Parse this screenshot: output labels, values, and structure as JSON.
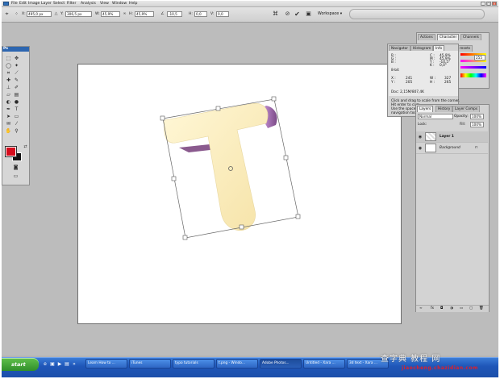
{
  "menu": {
    "items": [
      "File",
      "Edit",
      "Image",
      "Layer",
      "Select",
      "Filter",
      "Analysis",
      "View",
      "Window",
      "Help"
    ]
  },
  "options": {
    "x_label": "X:",
    "x_value": "495,0 px",
    "y_label": "Y:",
    "y_value": "306,5 px",
    "w_label": "W:",
    "w_value": "45,9%",
    "h_label": "H:",
    "h_value": "45,9%",
    "angle_value": "-10,5",
    "h_skew_label": "H:",
    "h_skew_value": "0,0",
    "v_skew_label": "V:",
    "v_skew_value": "0,0",
    "workspace_label": "Workspace ▾"
  },
  "tools": {
    "header": "Ps"
  },
  "panels": {
    "actions_tab": "Actions",
    "character_tab": "Character",
    "channels_tab": "Channels",
    "navigator_tab": "Navigator",
    "histogram_tab": "Histogram",
    "info_tab": "Info",
    "paths_tab": "Paths",
    "presets_tab": "resets",
    "color_value": "255"
  },
  "info": {
    "r_label": "R :",
    "g_label": "G :",
    "b_label": "B :",
    "c_label": "C :",
    "m_label": "M :",
    "y_label": "Y :",
    "k_label": "K :",
    "c_val": "45,9%",
    "m_val": "45,9%",
    "y_val": "-10,5°",
    "k_val": "0,0°",
    "bits_left": "8-bit",
    "x_label": "X :",
    "y2_label": "Y :",
    "x_val": "241",
    "y2_val": "205",
    "w_label": "W :",
    "h_label": "H :",
    "w_val": "327",
    "h_val": "265",
    "doc": "Doc: 2,15M/807,4K",
    "help1": "Click and drag to scale from the corner.",
    "help2": "Hit enter to com",
    "help3": "Use the spaceb",
    "help4": "navigation tools"
  },
  "layers": {
    "tab_layers": "Layers",
    "tab_history": "History",
    "tab_comps": "Layer Comps",
    "blend_mode": "Normal",
    "opacity_label": "Opacity:",
    "opacity_value": "100%",
    "lock_label": "Lock:",
    "fill_label": "Fill:",
    "fill_value": "100%",
    "rows": [
      {
        "name": "Layer 1"
      },
      {
        "name": "Background"
      }
    ]
  },
  "taskbar": {
    "start": "start",
    "tasks": [
      "Learn How to ...",
      "iTunes",
      "typo tutorials",
      "t.png - Windo...",
      "Adobe Photos...",
      "Untitled - Xara ...",
      "3d text - Xara ..."
    ],
    "watermark": "查字典 教程 网",
    "watermark_sub": "jiaocheng.chazidian.com"
  },
  "colors": {
    "foreground": "#d50d1d",
    "background": "#111111",
    "letter_face": "#fbf1c2",
    "letter_side": "#a86ea6",
    "taskbar": "#2259be",
    "start": "#3c9e36"
  }
}
